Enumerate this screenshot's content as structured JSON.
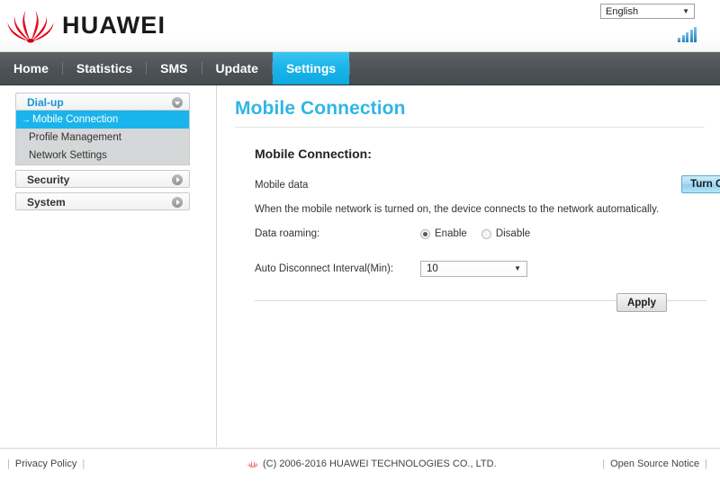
{
  "header": {
    "brand": "HUAWEI",
    "logo_icon": "huawei-flower-logo",
    "logo_color": "#e60012",
    "language": {
      "selected": "English",
      "caret_icon": "chevron-down-icon"
    },
    "signal": {
      "icon": "signal-bars-icon",
      "bars": 5,
      "color": "#1f7fb5"
    }
  },
  "nav": {
    "items": [
      {
        "label": "Home",
        "active": false
      },
      {
        "label": "Statistics",
        "active": false
      },
      {
        "label": "SMS",
        "active": false
      },
      {
        "label": "Update",
        "active": false
      },
      {
        "label": "Settings",
        "active": true
      }
    ],
    "active_color": "#18b4e9"
  },
  "sidebar": {
    "groups": [
      {
        "label": "Dial-up",
        "expanded": true,
        "arrow_icon": "chevron-down-circle-icon",
        "items": [
          {
            "label": "Mobile Connection",
            "selected": true,
            "marker": "→"
          },
          {
            "label": "Profile Management",
            "selected": false
          },
          {
            "label": "Network Settings",
            "selected": false
          }
        ]
      },
      {
        "label": "Security",
        "expanded": false,
        "arrow_icon": "chevron-right-circle-icon",
        "items": []
      },
      {
        "label": "System",
        "expanded": false,
        "arrow_icon": "chevron-right-circle-icon",
        "items": []
      }
    ]
  },
  "content": {
    "page_title": "Mobile Connection",
    "page_title_color": "#30b6e4",
    "section_title": "Mobile Connection:",
    "mobile_data_label": "Mobile data",
    "turn_on_label": "Turn On",
    "description": "When the mobile network is turned on, the device connects to the network automatically.",
    "data_roaming_label": "Data roaming:",
    "radio_enable_label": "Enable",
    "radio_disable_label": "Disable",
    "data_roaming_value": "Enable",
    "auto_disconnect_label": "Auto Disconnect Interval(Min):",
    "auto_disconnect_value": "10",
    "auto_disconnect_caret": "chevron-down-icon",
    "apply_label": "Apply"
  },
  "footer": {
    "privacy_policy": "Privacy Policy",
    "copyright": "(C) 2006-2016 HUAWEI TECHNOLOGIES CO., LTD.",
    "open_source_notice": "Open Source Notice",
    "mark_icon": "huawei-flower-logo-small"
  }
}
